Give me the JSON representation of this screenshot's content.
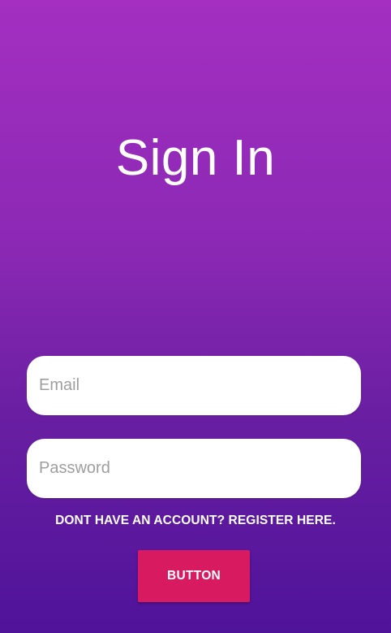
{
  "screen": {
    "title": "Sign In"
  },
  "form": {
    "email_placeholder": "Email",
    "email_value": "",
    "password_placeholder": "Password",
    "password_value": "",
    "register_link": "DONT HAVE AN ACCOUNT? REGISTER HERE.",
    "button_label": "BUTTON"
  },
  "colors": {
    "gradient_top": "#a42fc1",
    "gradient_bottom": "#4f139a",
    "button_bg": "#d81b60",
    "field_bg": "#ffffff"
  }
}
